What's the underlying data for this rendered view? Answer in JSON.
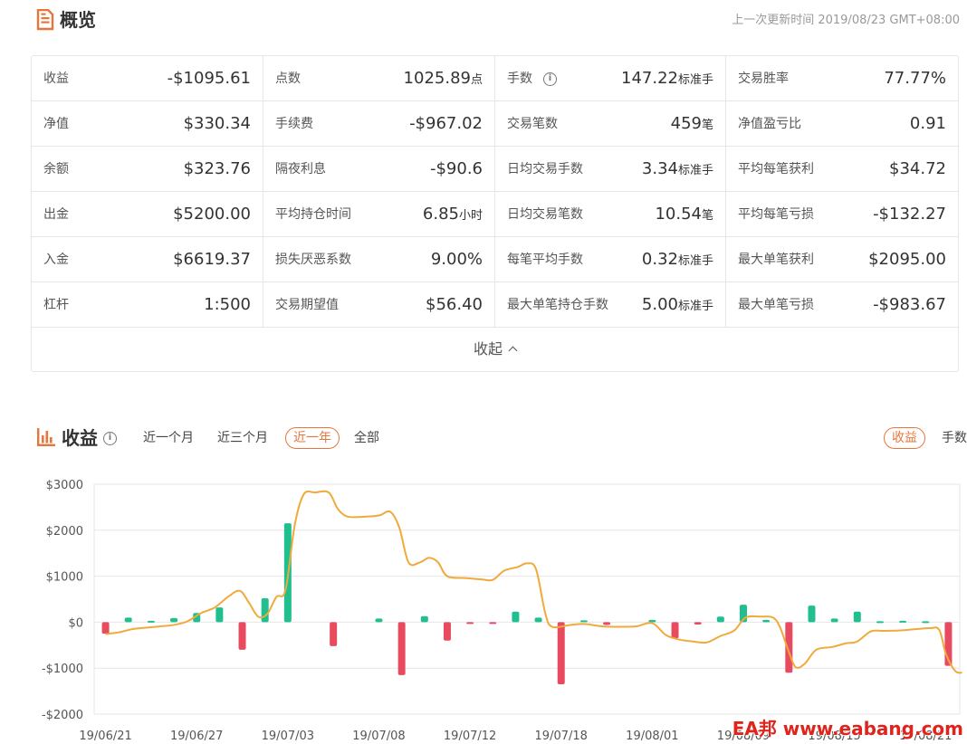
{
  "overview": {
    "title": "概览",
    "updated": "上一次更新时间 2019/08/23 GMT+08:00",
    "collapse_label": "收起",
    "accent": "#e8763a"
  },
  "stats": [
    [
      {
        "label": "收益",
        "value": "-$1095.61",
        "unit": ""
      },
      {
        "label": "点数",
        "value": "1025.89",
        "unit": "点"
      },
      {
        "label": "手数",
        "value": "147.22",
        "unit": "标准手",
        "info": true
      },
      {
        "label": "交易胜率",
        "value": "77.77%",
        "unit": ""
      }
    ],
    [
      {
        "label": "净值",
        "value": "$330.34",
        "unit": ""
      },
      {
        "label": "手续费",
        "value": "-$967.02",
        "unit": ""
      },
      {
        "label": "交易笔数",
        "value": "459",
        "unit": "笔"
      },
      {
        "label": "净值盈亏比",
        "value": "0.91",
        "unit": ""
      }
    ],
    [
      {
        "label": "余额",
        "value": "$323.76",
        "unit": ""
      },
      {
        "label": "隔夜利息",
        "value": "-$90.6",
        "unit": ""
      },
      {
        "label": "日均交易手数",
        "value": "3.34",
        "unit": "标准手"
      },
      {
        "label": "平均每笔获利",
        "value": "$34.72",
        "unit": ""
      }
    ],
    [
      {
        "label": "出金",
        "value": "$5200.00",
        "unit": ""
      },
      {
        "label": "平均持仓时间",
        "value": "6.85",
        "unit": "小时"
      },
      {
        "label": "日均交易笔数",
        "value": "10.54",
        "unit": "笔"
      },
      {
        "label": "平均每笔亏损",
        "value": "-$132.27",
        "unit": ""
      }
    ],
    [
      {
        "label": "入金",
        "value": "$6619.37",
        "unit": ""
      },
      {
        "label": "损失厌恶系数",
        "value": "9.00%",
        "unit": ""
      },
      {
        "label": "每笔平均手数",
        "value": "0.32",
        "unit": "标准手"
      },
      {
        "label": "最大单笔获利",
        "value": "$2095.00",
        "unit": ""
      }
    ],
    [
      {
        "label": "杠杆",
        "value": "1:500",
        "unit": ""
      },
      {
        "label": "交易期望值",
        "value": "$56.40",
        "unit": ""
      },
      {
        "label": "最大单笔持仓手数",
        "value": "5.00",
        "unit": "标准手"
      },
      {
        "label": "最大单笔亏损",
        "value": "-$983.67",
        "unit": ""
      }
    ]
  ],
  "profit": {
    "title": "收益",
    "ranges": [
      "近一个月",
      "近三个月",
      "近一年",
      "全部"
    ],
    "active_range": 2,
    "metrics": [
      "收益",
      "手数"
    ],
    "active_metric": 0
  },
  "chart_data": {
    "type": "bar",
    "ylim": [
      -2000,
      3000
    ],
    "yticks": [
      3000,
      2000,
      1000,
      0,
      -1000,
      -2000
    ],
    "ytick_labels": [
      "$3000",
      "$2000",
      "$1000",
      "$0",
      "-$1000",
      "-$2000"
    ],
    "xtick_labels": [
      "19/06/21",
      "19/06/27",
      "19/07/03",
      "19/07/08",
      "19/07/12",
      "19/07/18",
      "19/08/01",
      "19/08/09",
      "19/08/15",
      "19/08/21"
    ],
    "xtick_index": [
      0,
      4,
      8,
      12,
      16,
      20,
      24,
      28,
      32,
      36
    ],
    "bar_count": 38,
    "bars": [
      [
        0,
        -250
      ],
      [
        1,
        100
      ],
      [
        2,
        30
      ],
      [
        3,
        90
      ],
      [
        4,
        200
      ],
      [
        5,
        320
      ],
      [
        6,
        -600
      ],
      [
        7,
        520
      ],
      [
        8,
        2150
      ],
      [
        10,
        -520
      ],
      [
        12,
        80
      ],
      [
        13,
        -1150
      ],
      [
        14,
        130
      ],
      [
        15,
        -400
      ],
      [
        16,
        -30
      ],
      [
        17,
        -20
      ],
      [
        18,
        230
      ],
      [
        19,
        100
      ],
      [
        20,
        -1350
      ],
      [
        21,
        40
      ],
      [
        22,
        -60
      ],
      [
        24,
        50
      ],
      [
        25,
        -350
      ],
      [
        26,
        -50
      ],
      [
        27,
        120
      ],
      [
        28,
        380
      ],
      [
        29,
        50
      ],
      [
        30,
        -1100
      ],
      [
        31,
        360
      ],
      [
        32,
        80
      ],
      [
        33,
        230
      ],
      [
        34,
        20
      ],
      [
        35,
        30
      ],
      [
        36,
        20
      ],
      [
        37,
        -950
      ]
    ],
    "line": [
      [
        0.0,
        -260
      ],
      [
        0.6,
        -220
      ],
      [
        1.2,
        -150
      ],
      [
        2.0,
        -110
      ],
      [
        3.0,
        -60
      ],
      [
        3.6,
        20
      ],
      [
        4.2,
        200
      ],
      [
        4.8,
        320
      ],
      [
        5.4,
        560
      ],
      [
        5.9,
        680
      ],
      [
        6.3,
        420
      ],
      [
        6.7,
        120
      ],
      [
        7.1,
        180
      ],
      [
        7.5,
        550
      ],
      [
        7.9,
        700
      ],
      [
        8.3,
        2100
      ],
      [
        8.7,
        2780
      ],
      [
        9.2,
        2820
      ],
      [
        9.8,
        2820
      ],
      [
        10.2,
        2460
      ],
      [
        10.6,
        2300
      ],
      [
        11.2,
        2290
      ],
      [
        12.0,
        2320
      ],
      [
        12.5,
        2400
      ],
      [
        12.9,
        2050
      ],
      [
        13.3,
        1300
      ],
      [
        13.8,
        1300
      ],
      [
        14.2,
        1400
      ],
      [
        14.6,
        1300
      ],
      [
        15.0,
        1000
      ],
      [
        15.8,
        960
      ],
      [
        16.5,
        930
      ],
      [
        17.0,
        920
      ],
      [
        17.5,
        1120
      ],
      [
        18.1,
        1200
      ],
      [
        18.5,
        1280
      ],
      [
        18.9,
        1150
      ],
      [
        19.3,
        200
      ],
      [
        19.6,
        -100
      ],
      [
        20.4,
        -60
      ],
      [
        21.0,
        -40
      ],
      [
        21.8,
        -90
      ],
      [
        22.5,
        -100
      ],
      [
        23.3,
        -90
      ],
      [
        24.0,
        -20
      ],
      [
        24.6,
        -280
      ],
      [
        25.2,
        -380
      ],
      [
        25.8,
        -420
      ],
      [
        26.4,
        -440
      ],
      [
        27.0,
        -300
      ],
      [
        27.6,
        -180
      ],
      [
        28.1,
        100
      ],
      [
        28.8,
        120
      ],
      [
        29.3,
        100
      ],
      [
        29.6,
        -100
      ],
      [
        30.0,
        -650
      ],
      [
        30.3,
        -980
      ],
      [
        30.7,
        -900
      ],
      [
        31.2,
        -600
      ],
      [
        31.9,
        -540
      ],
      [
        32.5,
        -460
      ],
      [
        33.0,
        -420
      ],
      [
        33.6,
        -200
      ],
      [
        34.2,
        -190
      ],
      [
        34.9,
        -180
      ],
      [
        35.6,
        -150
      ],
      [
        36.2,
        -130
      ],
      [
        36.6,
        -170
      ],
      [
        36.9,
        -700
      ],
      [
        37.3,
        -1060
      ],
      [
        37.6,
        -1100
      ]
    ],
    "colors": {
      "positive": "#1fbf8f",
      "negative": "#e84a5f",
      "line": "#f0aa3c",
      "grid": "#e6e6e6"
    },
    "grid": true
  },
  "watermark": "EA邦 www.eabang.com"
}
